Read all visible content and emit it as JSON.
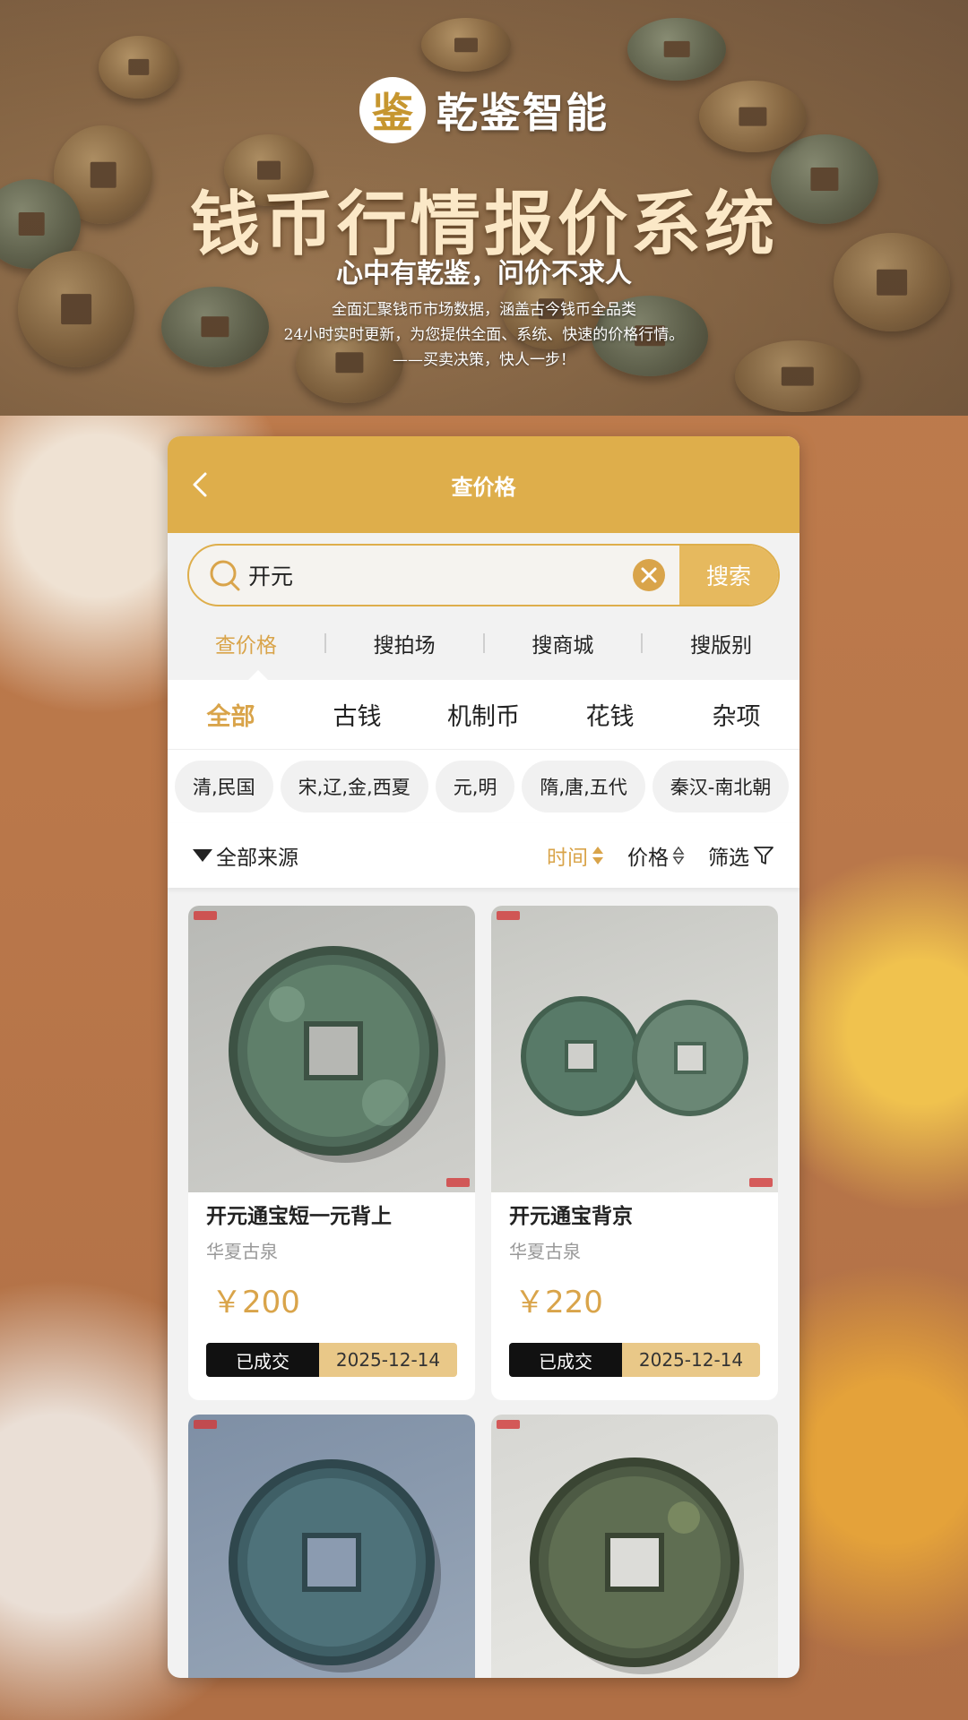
{
  "banner": {
    "logo_mark": "鉴",
    "logo_text": "乾鉴智能",
    "title": "钱币行情报价系统",
    "subtitle": "心中有乾鉴，问价不求人",
    "desc_line1": "全面汇聚钱币市场数据，涵盖古今钱币全品类",
    "desc_line2": "24小时实时更新，为您提供全面、系统、快速的价格行情。",
    "desc_line3": "——买卖决策，快人一步！"
  },
  "nav": {
    "title": "查价格",
    "back_icon": "chevron-left-icon"
  },
  "search": {
    "value": "开元",
    "placeholder": "",
    "button_label": "搜索"
  },
  "seg_tabs": [
    "查价格",
    "搜拍场",
    "搜商城",
    "搜版别"
  ],
  "seg_active": 0,
  "category_tabs": [
    "全部",
    "古钱",
    "机制币",
    "花钱",
    "杂项"
  ],
  "category_active": 0,
  "chips": [
    "清,民国",
    "宋,辽,金,西夏",
    "元,明",
    "隋,唐,五代",
    "秦汉-南北朝"
  ],
  "sort": {
    "source_label": "全部来源",
    "time_label": "时间",
    "price_label": "价格",
    "filter_label": "筛选"
  },
  "items": [
    {
      "title": "开元通宝短一元背上",
      "seller": "华夏古泉",
      "price": "￥200",
      "status": "已成交",
      "date": "2025-12-14"
    },
    {
      "title": "开元通宝背京",
      "seller": "华夏古泉",
      "price": "￥220",
      "status": "已成交",
      "date": "2025-12-14"
    },
    {
      "title": "",
      "seller": "",
      "price": "",
      "status": "",
      "date": ""
    },
    {
      "title": "",
      "seller": "",
      "price": "",
      "status": "",
      "date": ""
    }
  ],
  "colors": {
    "accent": "#deae4b",
    "price": "#d9a44a",
    "badge_dark": "#111111",
    "date_bg": "#e9c888"
  }
}
